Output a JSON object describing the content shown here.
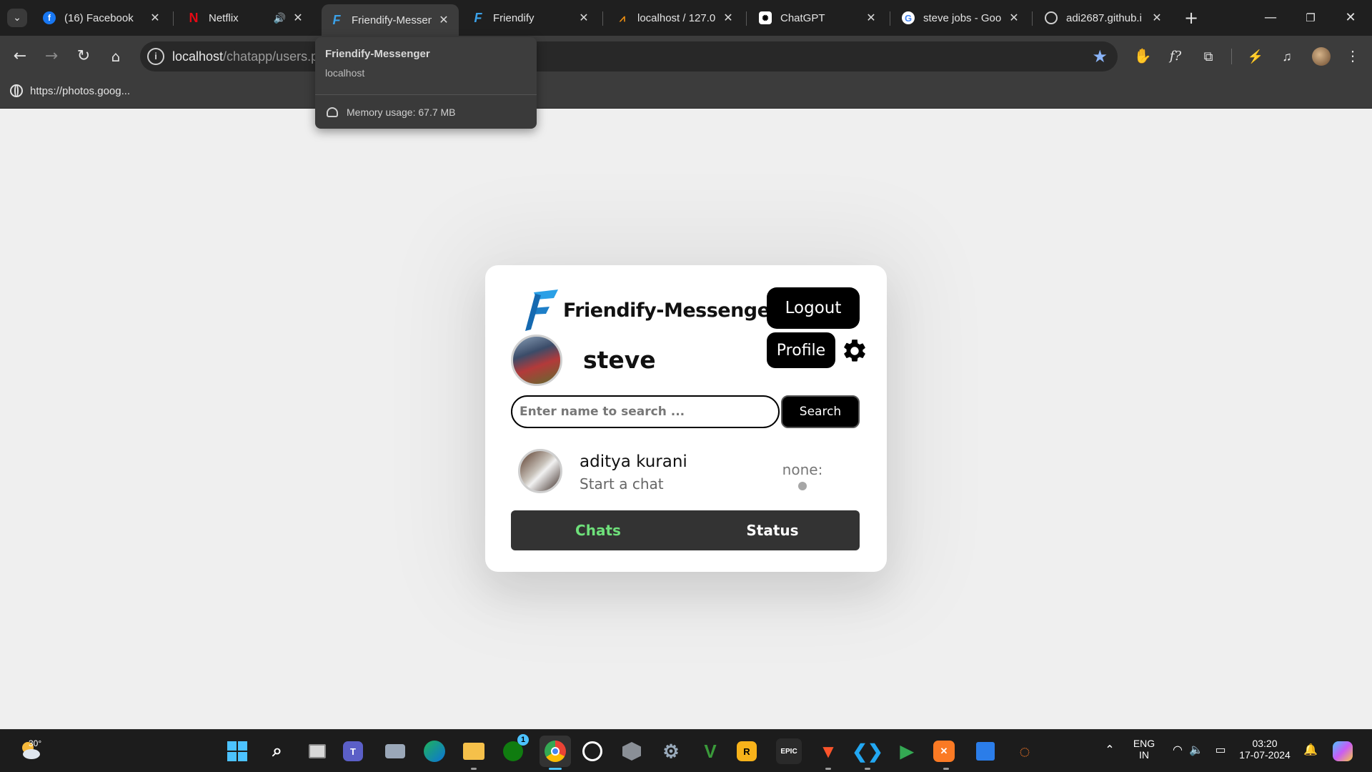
{
  "browser": {
    "tabs": [
      {
        "title": "(16) Facebook",
        "icon": "facebook-icon"
      },
      {
        "title": "Netflix",
        "icon": "netflix-icon"
      },
      {
        "title": "Friendify-Messenger",
        "icon": "friendify-icon"
      },
      {
        "title": "Friendify",
        "icon": "friendify-icon"
      },
      {
        "title": "localhost / 127.0",
        "icon": "phpmyadmin-icon"
      },
      {
        "title": "ChatGPT",
        "icon": "chatgpt-icon"
      },
      {
        "title": "steve jobs - Goo",
        "icon": "google-icon"
      },
      {
        "title": "adi2687.github.i",
        "icon": "globe-icon"
      }
    ],
    "active_tab": 2,
    "address": {
      "host": "localhost",
      "path": "/chatapp/users.php"
    },
    "bookmarks": [
      {
        "label": "https://photos.goog..."
      }
    ],
    "hovercard": {
      "title": "Friendify-Messenger",
      "host": "localhost",
      "memory": "Memory usage: 67.7 MB"
    },
    "colors": {
      "accent": "#8ab4f8",
      "frame": "#1f1f1f",
      "toolbar": "#3c3c3c"
    }
  },
  "app": {
    "brand": "Friendify-Messenger",
    "logout_label": "Logout",
    "profile_label": "Profile",
    "current_user": {
      "name": "steve"
    },
    "search": {
      "placeholder": "Enter name to search ...",
      "button_label": "Search"
    },
    "chats": [
      {
        "name": "aditya kurani",
        "last_message": "Start a chat",
        "status": "none:"
      }
    ],
    "nav": {
      "chats_label": "Chats",
      "status_label": "Status",
      "active": "Chats"
    },
    "colors": {
      "active_nav": "#6ee07a",
      "button_bg": "#000000",
      "logo_blue": "#1e8bd6"
    }
  },
  "taskbar": {
    "weather_temp": "30°",
    "apps": [
      "start",
      "search",
      "task-view",
      "teams",
      "camera",
      "edge",
      "file-explorer",
      "xbox",
      "chrome",
      "whatsapp",
      "app-unknown",
      "settings",
      "vim",
      "rockstar",
      "epic-games",
      "brave",
      "vscode",
      "google-play-games",
      "xampp",
      "calendar",
      "jupyter"
    ],
    "xbox_badge": "1",
    "language": {
      "line1": "ENG",
      "line2": "IN"
    },
    "time": "03:20",
    "date": "17-07-2024"
  }
}
